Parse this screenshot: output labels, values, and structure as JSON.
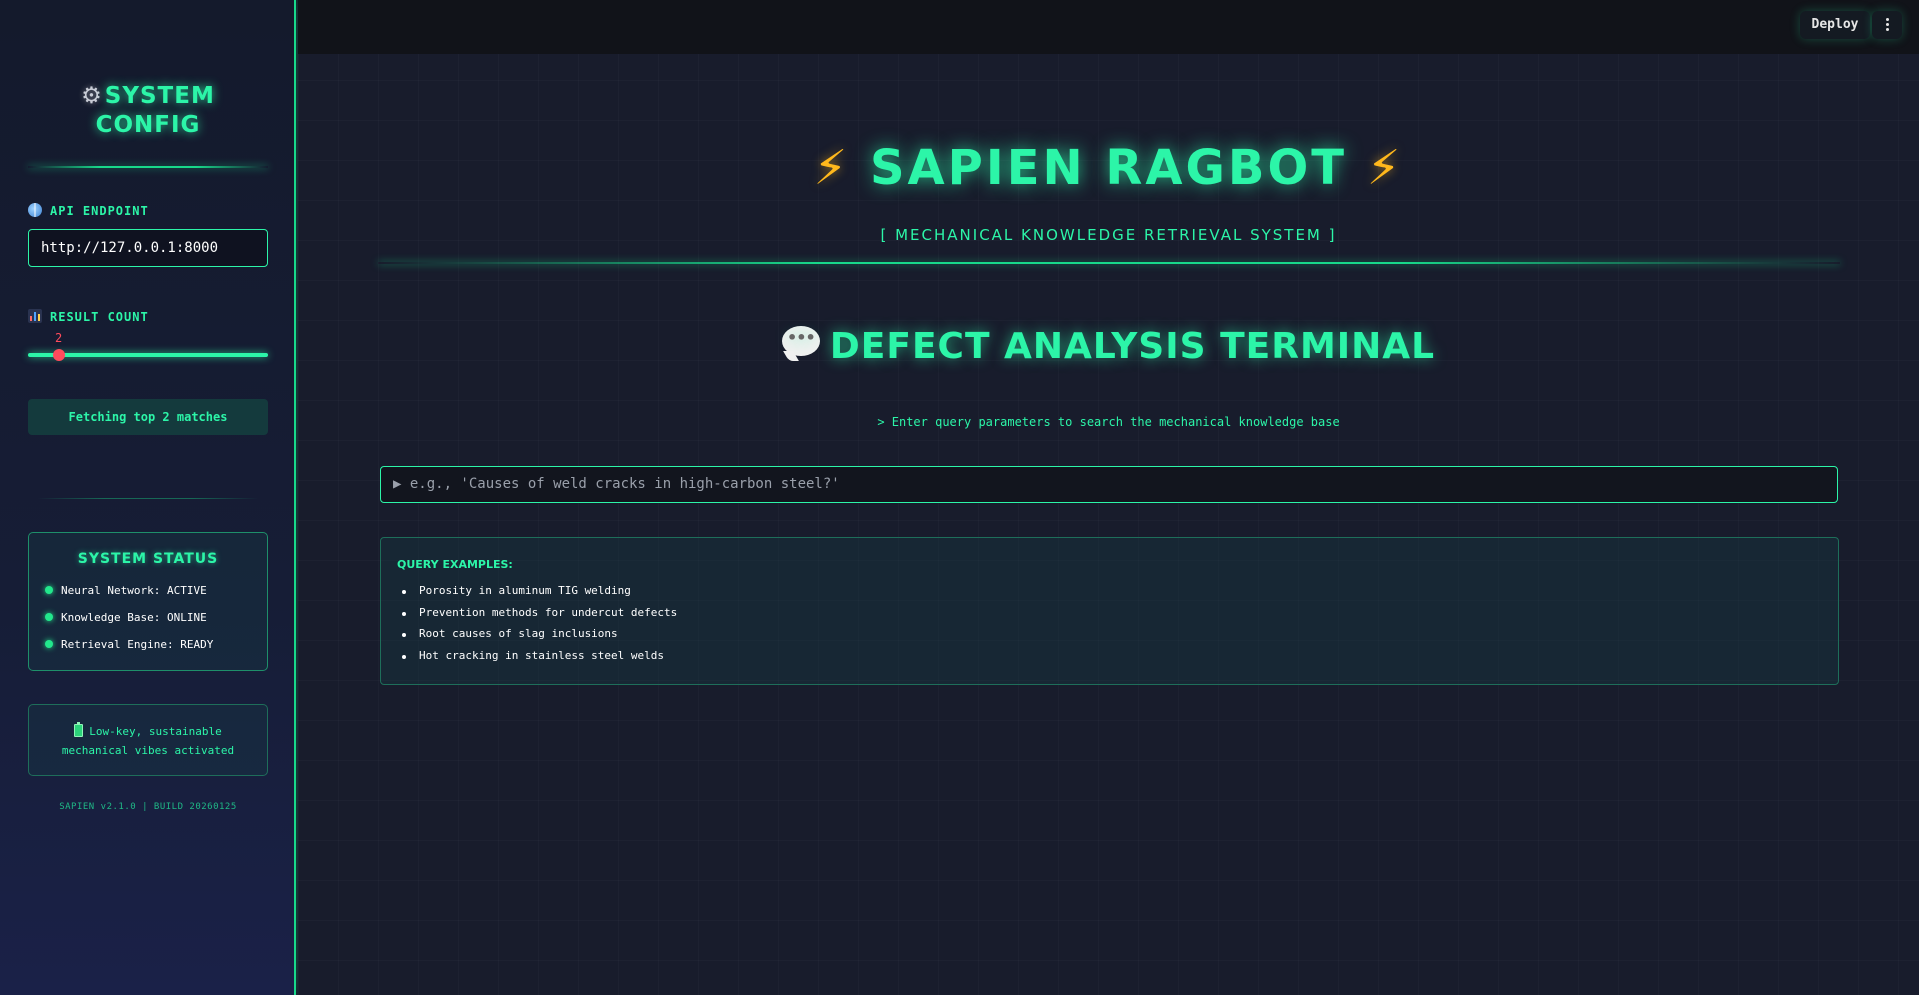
{
  "sidebar": {
    "title_icon": "gear-icon",
    "title_line1": "SYSTEM",
    "title_line2": "CONFIG",
    "api_label": "API ENDPOINT",
    "api_value": "http://127.0.0.1:8000",
    "result_label": "RESULT COUNT",
    "result_count": "2",
    "fetch_text": "Fetching top 2 matches",
    "status_title": "SYSTEM STATUS",
    "status_items": [
      "Neural Network: ACTIVE",
      "Knowledge Base: ONLINE",
      "Retrieval Engine: READY"
    ],
    "vibe_line1": "Low-key, sustainable",
    "vibe_line2": "mechanical vibes activated",
    "version": "SAPIEN v2.1.0 | BUILD 20260125"
  },
  "topbar": {
    "deploy_label": "Deploy"
  },
  "main": {
    "title": "SAPIEN RAGBOT",
    "bolt": "⚡",
    "subtitle": "[ MECHANICAL KNOWLEDGE RETRIEVAL SYSTEM ]",
    "section_title": "DEFECT ANALYSIS TERMINAL",
    "section_hint": "> Enter query parameters to search the mechanical knowledge base",
    "query_placeholder": "▶ e.g., 'Causes of weld cracks in high-carbon steel?'",
    "examples_title": "QUERY EXAMPLES:",
    "examples": [
      "Porosity in aluminum TIG welding",
      "Prevention methods for undercut defects",
      "Root causes of slag inclusions",
      "Hot cracking in stainless steel welds"
    ]
  },
  "colors": {
    "accent": "#2cf5a8",
    "slider": "#ff4b5c",
    "bolt": "#ffb81c",
    "background": "#181c2c"
  }
}
